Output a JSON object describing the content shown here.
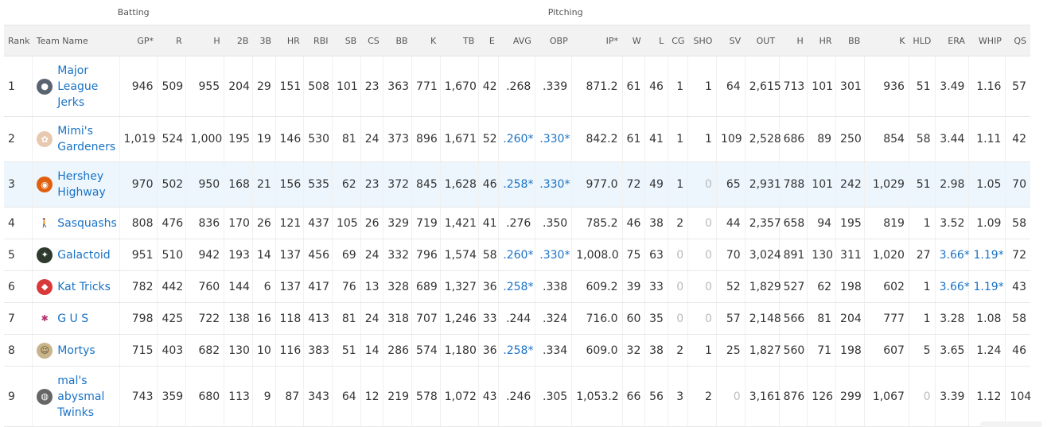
{
  "groups": {
    "batting": "Batting",
    "pitching": "Pitching"
  },
  "columns": [
    "Rank",
    "Team Name",
    "GP*",
    "R",
    "H",
    "2B",
    "3B",
    "HR",
    "RBI",
    "SB",
    "CS",
    "BB",
    "K",
    "TB",
    "E",
    "AVG",
    "OBP",
    "IP*",
    "W",
    "L",
    "CG",
    "SHO",
    "SV",
    "OUT",
    "H",
    "HR",
    "BB",
    "K",
    "HLD",
    "ERA",
    "WHIP",
    "QS"
  ],
  "rows": [
    {
      "rank": "1",
      "team": "Major League Jerks",
      "logo": "helmet-avatar-icon",
      "cells": [
        "946",
        "509",
        "955",
        "204",
        "29",
        "151",
        "508",
        "101",
        "23",
        "363",
        "771",
        "1,670",
        "42",
        ".268",
        ".339",
        "871.2",
        "61",
        "46",
        "1",
        "1",
        "64",
        "2,615",
        "713",
        "101",
        "301",
        "936",
        "51",
        "3.49",
        "1.16",
        "57"
      ]
    },
    {
      "rank": "2",
      "team": "Mimi's Gardeners",
      "logo": "flower-avatar-icon",
      "cells": [
        "1,019",
        "524",
        "1,000",
        "195",
        "19",
        "146",
        "530",
        "81",
        "24",
        "373",
        "896",
        "1,671",
        "52",
        ".260*",
        ".330*",
        "842.2",
        "61",
        "41",
        "1",
        "1",
        "109",
        "2,528",
        "686",
        "89",
        "250",
        "854",
        "58",
        "3.44",
        "1.11",
        "42"
      ]
    },
    {
      "rank": "3",
      "team": "Hershey Highway",
      "logo": "oriole-avatar-icon",
      "cells": [
        "970",
        "502",
        "950",
        "168",
        "21",
        "156",
        "535",
        "62",
        "23",
        "372",
        "845",
        "1,628",
        "46",
        ".258*",
        ".330*",
        "977.0",
        "72",
        "49",
        "1",
        "0",
        "65",
        "2,931",
        "788",
        "101",
        "242",
        "1,029",
        "51",
        "2.98",
        "1.05",
        "70"
      ]
    },
    {
      "rank": "4",
      "team": "Sasquashs",
      "logo": "bigfoot-avatar-icon",
      "cells": [
        "808",
        "476",
        "836",
        "170",
        "26",
        "121",
        "437",
        "105",
        "26",
        "329",
        "719",
        "1,421",
        "41",
        ".276",
        ".350",
        "785.2",
        "46",
        "38",
        "2",
        "0",
        "44",
        "2,357",
        "658",
        "94",
        "195",
        "819",
        "1",
        "3.52",
        "1.09",
        "58"
      ]
    },
    {
      "rank": "5",
      "team": "Galactoid",
      "logo": "alien-avatar-icon",
      "cells": [
        "951",
        "510",
        "942",
        "193",
        "14",
        "137",
        "456",
        "69",
        "24",
        "332",
        "796",
        "1,574",
        "58",
        ".260*",
        ".330*",
        "1,008.0",
        "75",
        "63",
        "0",
        "0",
        "70",
        "3,024",
        "891",
        "130",
        "311",
        "1,020",
        "27",
        "3.66*",
        "1.19*",
        "72"
      ]
    },
    {
      "rank": "6",
      "team": "Kat Tricks",
      "logo": "cat-avatar-icon",
      "cells": [
        "782",
        "442",
        "760",
        "144",
        "6",
        "137",
        "417",
        "76",
        "13",
        "328",
        "689",
        "1,327",
        "36",
        ".258*",
        ".338",
        "609.2",
        "39",
        "33",
        "0",
        "0",
        "52",
        "1,829",
        "527",
        "62",
        "198",
        "602",
        "1",
        "3.66*",
        "1.19*",
        "43"
      ]
    },
    {
      "rank": "7",
      "team": "G U S",
      "logo": "leaf-avatar-icon",
      "cells": [
        "798",
        "425",
        "722",
        "138",
        "16",
        "118",
        "413",
        "81",
        "24",
        "318",
        "707",
        "1,246",
        "33",
        ".244",
        ".324",
        "716.0",
        "60",
        "35",
        "0",
        "0",
        "57",
        "2,148",
        "566",
        "81",
        "204",
        "777",
        "1",
        "3.28",
        "1.08",
        "58"
      ]
    },
    {
      "rank": "8",
      "team": "Mortys",
      "logo": "morty-avatar-icon",
      "cells": [
        "715",
        "403",
        "682",
        "130",
        "10",
        "116",
        "383",
        "51",
        "14",
        "286",
        "574",
        "1,180",
        "36",
        ".258*",
        ".334",
        "609.0",
        "32",
        "38",
        "2",
        "1",
        "25",
        "1,827",
        "560",
        "71",
        "198",
        "607",
        "5",
        "3.65",
        "1.24",
        "46"
      ]
    },
    {
      "rank": "9",
      "team": "mal's abysmal Twinks",
      "logo": "robot-avatar-icon",
      "cells": [
        "743",
        "359",
        "680",
        "113",
        "9",
        "87",
        "343",
        "64",
        "12",
        "219",
        "578",
        "1,072",
        "43",
        ".246",
        ".305",
        "1,053.2",
        "66",
        "56",
        "3",
        "2",
        "0",
        "3,161",
        "876",
        "126",
        "299",
        "1,067",
        "0",
        "3.39",
        "1.12",
        "104"
      ]
    }
  ],
  "colors": {
    "link": "#1a73c6",
    "header_bg": "#f2f2f2",
    "highlight_row": "#edf6fc",
    "muted_zero": "#bbbbbb"
  }
}
